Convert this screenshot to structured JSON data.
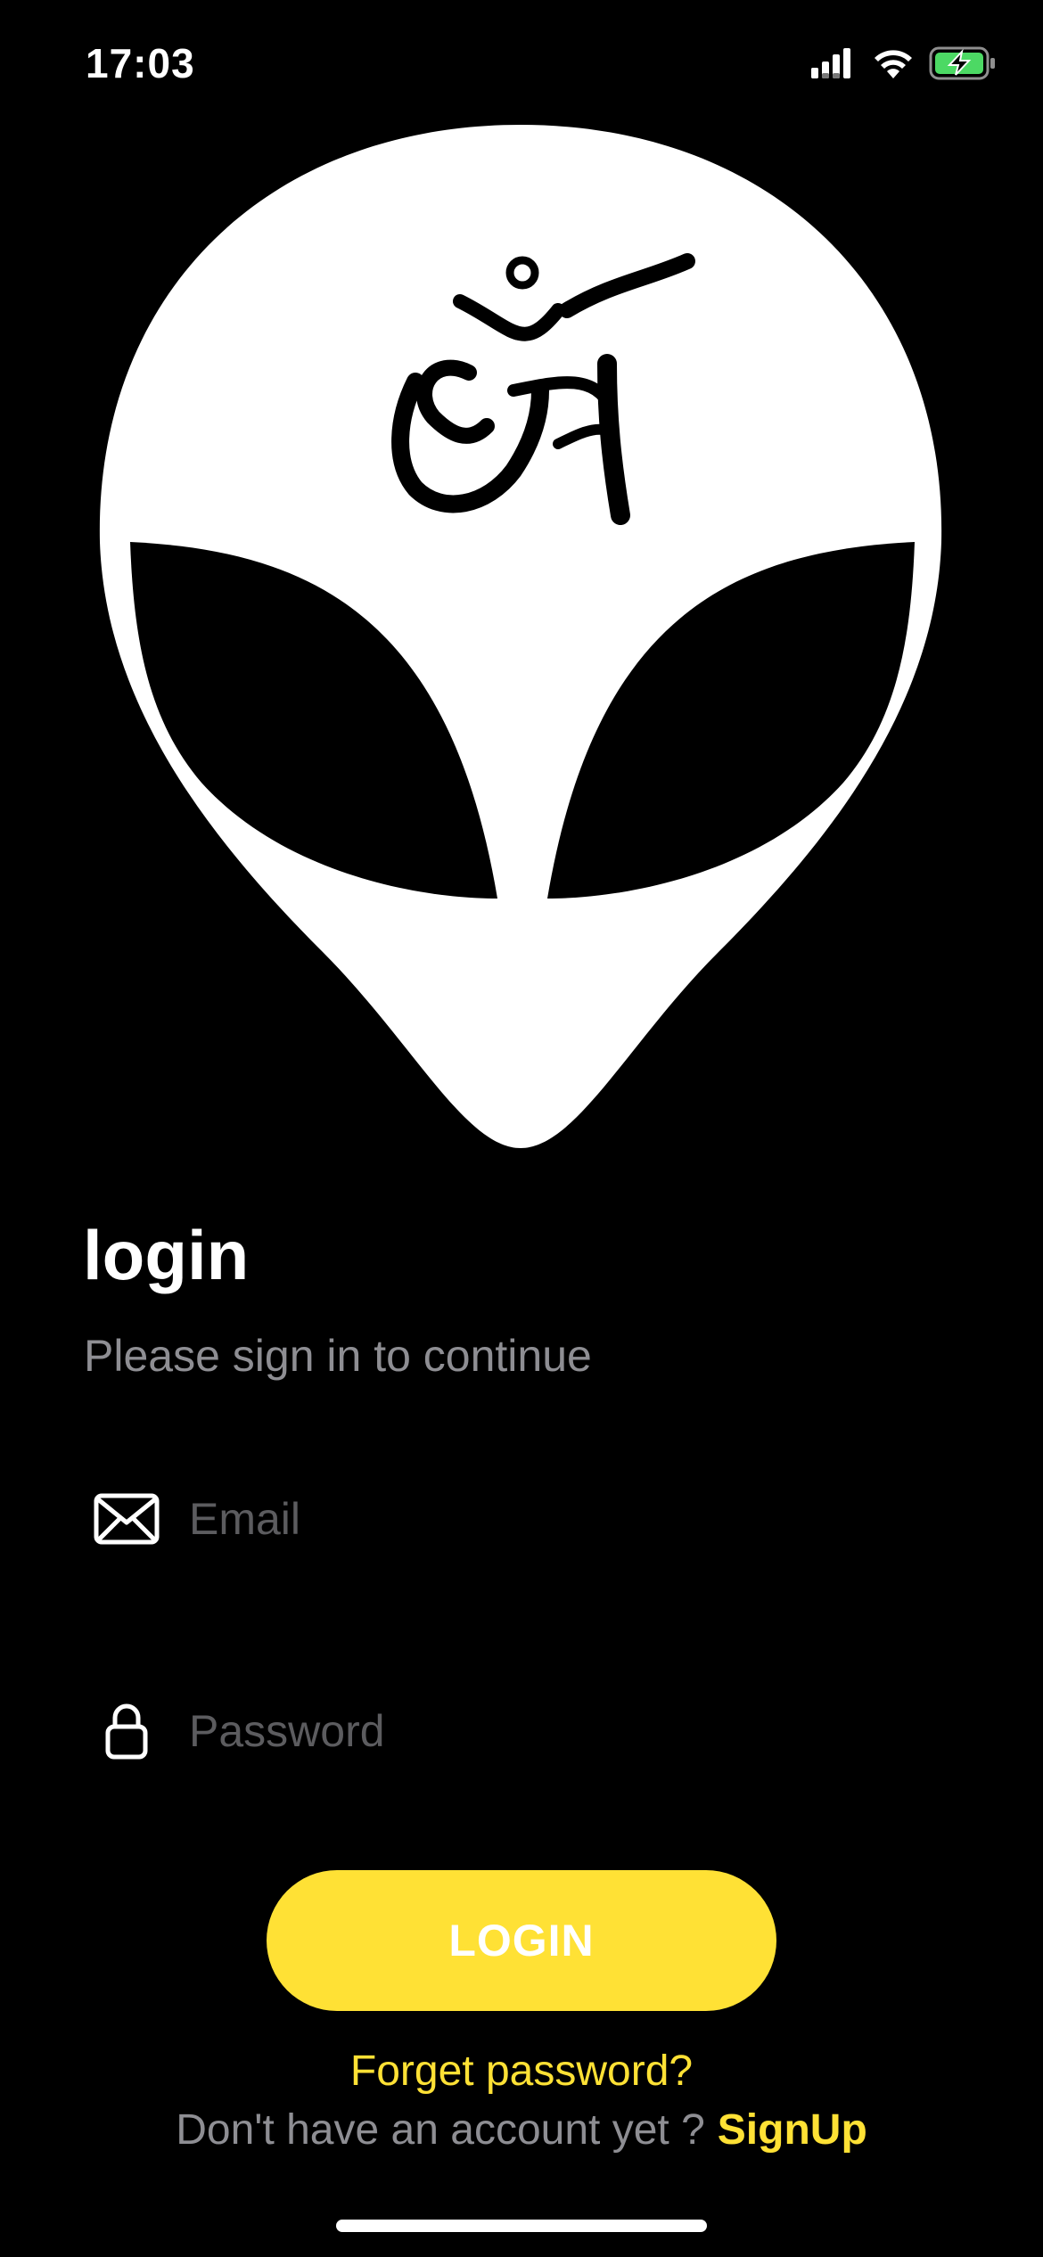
{
  "status_bar": {
    "time": "17:03",
    "icons": [
      "cellular-signal-icon",
      "wifi-icon",
      "battery-charging-icon"
    ],
    "battery_color": "#4cd964"
  },
  "logo": {
    "icon": "alien-head-om-logo"
  },
  "header": {
    "title": "login",
    "subtitle": "Please sign in to continue"
  },
  "form": {
    "email": {
      "icon": "envelope-icon",
      "placeholder": "Email",
      "value": ""
    },
    "password": {
      "icon": "lock-icon",
      "placeholder": "Password",
      "value": ""
    },
    "login_label": "LOGIN"
  },
  "footer": {
    "forgot_label": "Forget password?",
    "signup_prompt": "Don't have an account yet ?",
    "signup_label": "SignUp"
  },
  "colors": {
    "background": "#000000",
    "accent": "#ffe135",
    "muted_text": "#8e8e93",
    "placeholder": "#5c5c5f"
  }
}
